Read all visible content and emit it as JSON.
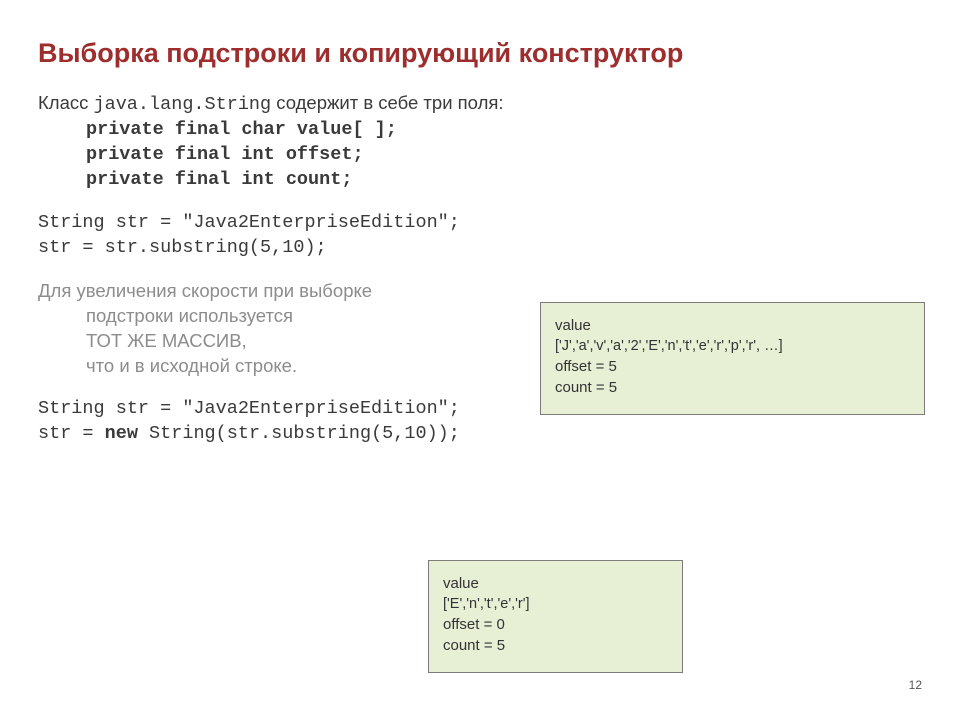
{
  "title": "Выборка подстроки и копирующий конструктор",
  "intro_left": "Класс ",
  "intro_code": "java.lang.String",
  "intro_right": "  содержит в себе три поля:",
  "field1": "private final char value[ ];",
  "field2": "private final int offset;",
  "field3": "private final int count;",
  "code1a": "String str = \"Java2EnterpriseEdition\";",
  "code1b": "str = str.substring(5,10);",
  "explain1": "Для увеличения скорости при выборке",
  "explain2": "подстроки используется",
  "explain3": "ТОТ ЖЕ МАССИВ,",
  "explain4": "что и в исходной строке.",
  "code2a": "String str = \"Java2EnterpriseEdition\";",
  "code2b_left": "str = ",
  "code2b_new": "new",
  "code2b_right": " String(str.substring(5,10));",
  "box1": {
    "value_label": "value",
    "array": "['J','a','v','a','2','E','n','t','e','r','p','r', …]",
    "offset": "offset = 5",
    "count": "count = 5"
  },
  "box2": {
    "value_label": "value",
    "array": "['E','n','t','e','r']",
    "offset": "offset = 0",
    "count": "count = 5"
  },
  "page_number": "12"
}
